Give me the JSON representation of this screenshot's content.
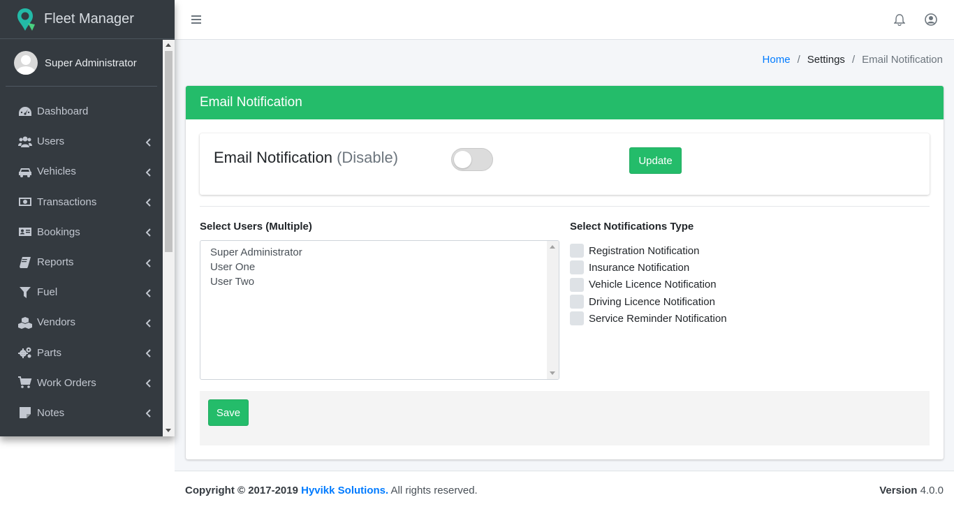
{
  "brand": {
    "title": "Fleet Manager"
  },
  "user": {
    "name": "Super Administrator"
  },
  "sidebar": {
    "items": [
      {
        "label": "Dashboard",
        "icon": "dashboard-icon",
        "has_chevron": false
      },
      {
        "label": "Users",
        "icon": "users-icon",
        "has_chevron": true
      },
      {
        "label": "Vehicles",
        "icon": "car-icon",
        "has_chevron": true
      },
      {
        "label": "Transactions",
        "icon": "money-icon",
        "has_chevron": true
      },
      {
        "label": "Bookings",
        "icon": "address-card-icon",
        "has_chevron": true
      },
      {
        "label": "Reports",
        "icon": "book-icon",
        "has_chevron": true
      },
      {
        "label": "Fuel",
        "icon": "filter-icon",
        "has_chevron": true
      },
      {
        "label": "Vendors",
        "icon": "cubes-icon",
        "has_chevron": true
      },
      {
        "label": "Parts",
        "icon": "gears-icon",
        "has_chevron": true
      },
      {
        "label": "Work Orders",
        "icon": "cart-icon",
        "has_chevron": true
      },
      {
        "label": "Notes",
        "icon": "sticky-note-icon",
        "has_chevron": true
      }
    ]
  },
  "breadcrumb": {
    "home": "Home",
    "sep": "/",
    "settings": "Settings",
    "current": "Email Notification"
  },
  "card": {
    "header": "Email Notification",
    "notif_title": "Email Notification",
    "notif_status": "(Disable)",
    "toggle_on": false,
    "update_label": "Update",
    "users_label": "Select Users (Multiple)",
    "users": [
      "Super Administrator",
      "User One",
      "User Two"
    ],
    "types_label": "Select Notifications Type",
    "types": [
      "Registration Notification",
      "Insurance Notification",
      "Vehicle Licence Notification",
      "Driving Licence Notification",
      "Service Reminder Notification"
    ],
    "save_label": "Save"
  },
  "footer": {
    "copyright_prefix": "Copyright © 2017-2019",
    "company": "Hyvikk Solutions.",
    "rights": " All rights reserved.",
    "version_label": "Version",
    "version": "4.0.0"
  },
  "colors": {
    "accent": "#24bc6a",
    "sidebar_bg": "#343a40",
    "link": "#007bff"
  }
}
